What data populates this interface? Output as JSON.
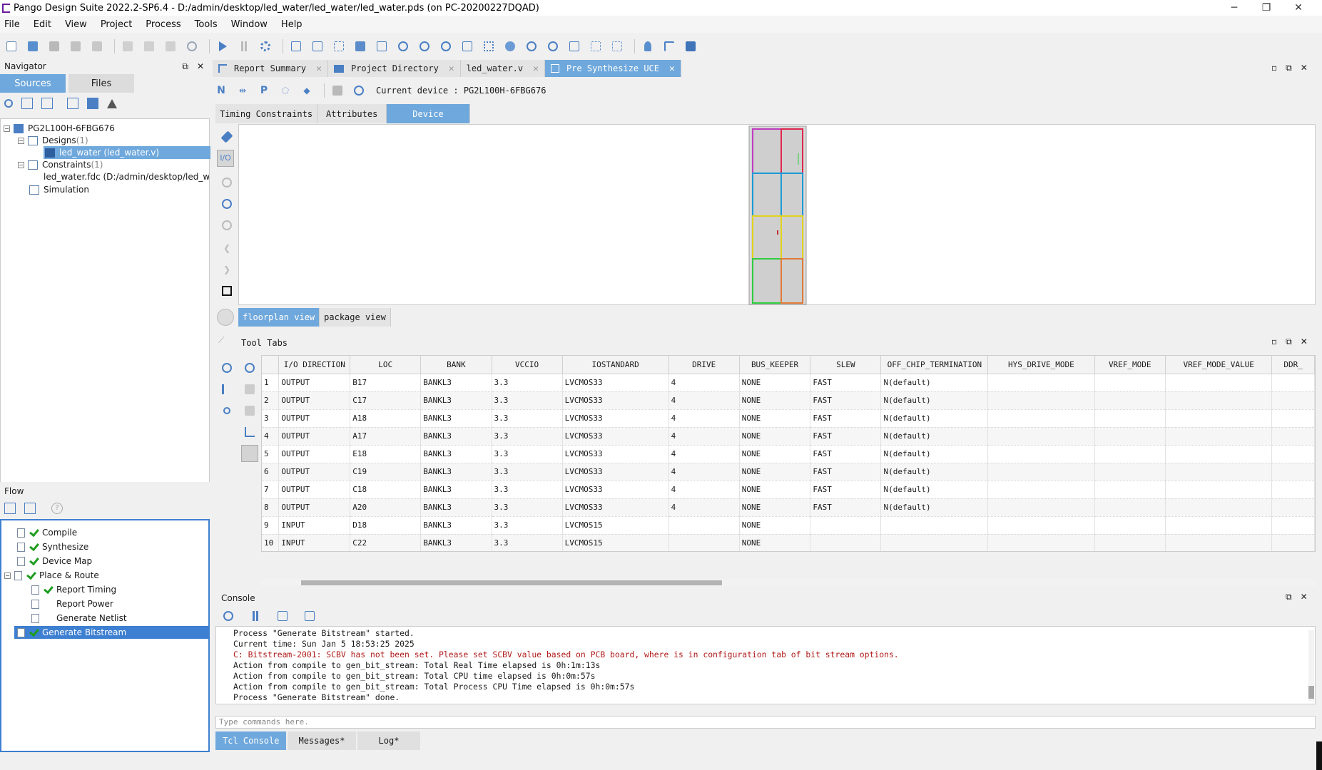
{
  "window": {
    "title": "Pango Design Suite 2022.2-SP6.4 - D:/admin/desktop/led_water/led_water/led_water.pds (on PC-20200227DQAD)",
    "minimize": "─",
    "maximize": "❐",
    "close": "✕"
  },
  "menu": [
    "File",
    "Edit",
    "View",
    "Project",
    "Process",
    "Tools",
    "Window",
    "Help"
  ],
  "navigator": {
    "title": "Navigator",
    "tabs": [
      "Sources",
      "Files"
    ],
    "tree": {
      "device": "PG2L100H-6FBG676",
      "designs_label": "Designs",
      "designs_count": "(1)",
      "design_item": "led_water (led_water.v)",
      "constraints_label": "Constraints",
      "constraints_count": "(1)",
      "constraint_item": "led_water.fdc (D:/admin/desktop/led_water",
      "simulation_label": "Simulation"
    }
  },
  "flow": {
    "title": "Flow",
    "help": "?",
    "items": [
      "Compile",
      "Synthesize",
      "Device Map",
      "Place & Route",
      "Report Timing",
      "Report Power",
      "Generate Netlist",
      "Generate Bitstream"
    ]
  },
  "doc_tabs": [
    "Report Summary",
    "Project Directory",
    "led_water.v",
    "Pre Synthesize UCE"
  ],
  "uce": {
    "current_device": "Current device : PG2L100H-6FBG676",
    "sub_tabs": [
      "Timing Constraints",
      "Attributes",
      "Device"
    ],
    "view_tabs": [
      "floorplan view",
      "package view"
    ]
  },
  "tool_tabs": {
    "title": "Tool Tabs",
    "columns": [
      "I/O DIRECTION",
      "LOC",
      "BANK",
      "VCCIO",
      "IOSTANDARD",
      "DRIVE",
      "BUS_KEEPER",
      "SLEW",
      "OFF_CHIP_TERMINATION",
      "HYS_DRIVE_MODE",
      "VREF_MODE",
      "VREF_MODE_VALUE",
      "DDR_"
    ],
    "rows": [
      [
        "1",
        "OUTPUT",
        "B17",
        "BANKL3",
        "3.3",
        "LVCMOS33",
        "4",
        "NONE",
        "FAST",
        "N(default)",
        "",
        "",
        "",
        ""
      ],
      [
        "2",
        "OUTPUT",
        "C17",
        "BANKL3",
        "3.3",
        "LVCMOS33",
        "4",
        "NONE",
        "FAST",
        "N(default)",
        "",
        "",
        "",
        ""
      ],
      [
        "3",
        "OUTPUT",
        "A18",
        "BANKL3",
        "3.3",
        "LVCMOS33",
        "4",
        "NONE",
        "FAST",
        "N(default)",
        "",
        "",
        "",
        ""
      ],
      [
        "4",
        "OUTPUT",
        "A17",
        "BANKL3",
        "3.3",
        "LVCMOS33",
        "4",
        "NONE",
        "FAST",
        "N(default)",
        "",
        "",
        "",
        ""
      ],
      [
        "5",
        "OUTPUT",
        "E18",
        "BANKL3",
        "3.3",
        "LVCMOS33",
        "4",
        "NONE",
        "FAST",
        "N(default)",
        "",
        "",
        "",
        ""
      ],
      [
        "6",
        "OUTPUT",
        "C19",
        "BANKL3",
        "3.3",
        "LVCMOS33",
        "4",
        "NONE",
        "FAST",
        "N(default)",
        "",
        "",
        "",
        ""
      ],
      [
        "7",
        "OUTPUT",
        "C18",
        "BANKL3",
        "3.3",
        "LVCMOS33",
        "4",
        "NONE",
        "FAST",
        "N(default)",
        "",
        "",
        "",
        ""
      ],
      [
        "8",
        "OUTPUT",
        "A20",
        "BANKL3",
        "3.3",
        "LVCMOS33",
        "4",
        "NONE",
        "FAST",
        "N(default)",
        "",
        "",
        "",
        ""
      ],
      [
        "9",
        "INPUT",
        "D18",
        "BANKL3",
        "3.3",
        "LVCMOS15",
        "",
        "NONE",
        "",
        "",
        "",
        "",
        "",
        ""
      ],
      [
        "10",
        "INPUT",
        "C22",
        "BANKL3",
        "3.3",
        "LVCMOS15",
        "",
        "NONE",
        "",
        "",
        "",
        "",
        "",
        ""
      ]
    ]
  },
  "console": {
    "title": "Console",
    "lines": [
      {
        "text": "Process \"Generate Bitstream\" started.",
        "err": false
      },
      {
        "text": "Current time: Sun Jan  5 18:53:25 2025",
        "err": false
      },
      {
        "text": "C: Bitstream-2001: SCBV has not been set. Please set SCBV value based on PCB board, where is in configuration tab of bit stream options.",
        "err": true
      },
      {
        "text": "Action from compile to gen_bit_stream: Total Real Time elapsed is 0h:1m:13s",
        "err": false
      },
      {
        "text": "Action from compile to gen_bit_stream: Total CPU time elapsed is 0h:0m:57s",
        "err": false
      },
      {
        "text": "Action from compile to gen_bit_stream: Total Process CPU Time elapsed is 0h:0m:57s",
        "err": false
      },
      {
        "text": "Process \"Generate Bitstream\" done.",
        "err": false
      }
    ],
    "placeholder": "Type commands here.",
    "tabs": [
      "Tcl Console",
      "Messages*",
      "Log*"
    ]
  },
  "colors": {
    "accent": "#6fa8dc",
    "selection": "#3d7fd1",
    "check": "#1e9c1e",
    "error": "#b01818"
  }
}
